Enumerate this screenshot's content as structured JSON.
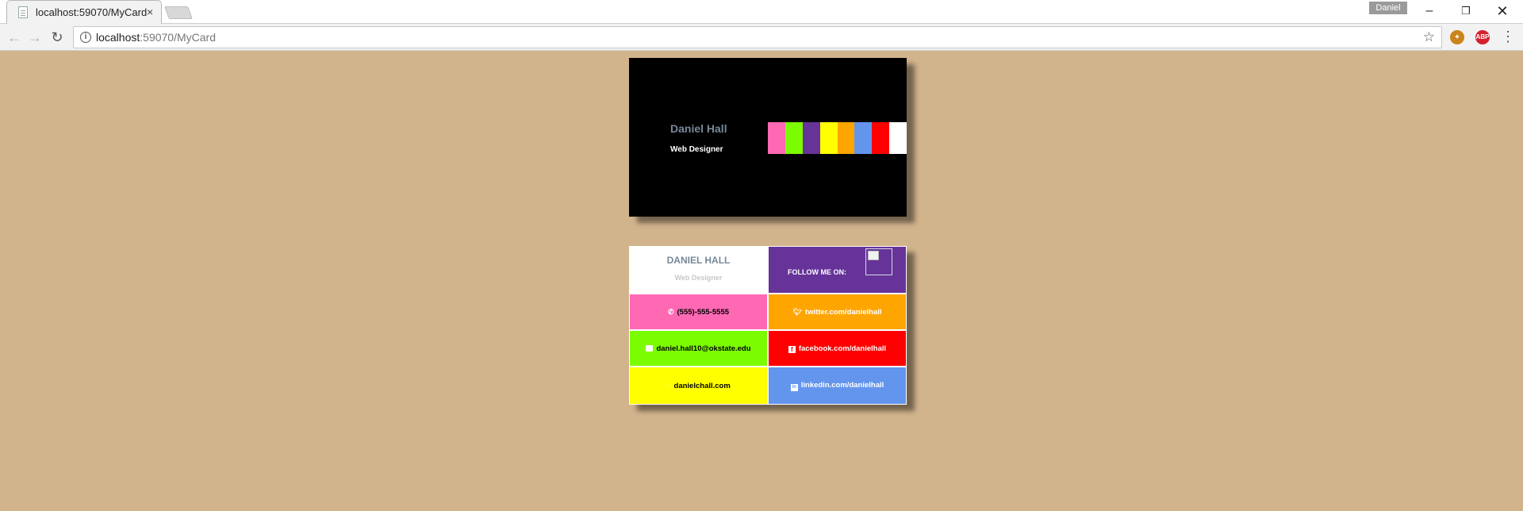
{
  "browser": {
    "tab_title": "localhost:59070/MyCard",
    "tab_close": "×",
    "profile_name": "Daniel",
    "url_host": "localhost",
    "url_path": ":59070/MyCard",
    "window_min": "–",
    "window_max": "❐",
    "window_close": "✕",
    "nav_back": "←",
    "nav_forward": "→",
    "nav_reload": "↻",
    "star": "☆",
    "ext_abp": "ABP",
    "menu": "⋮"
  },
  "page": {
    "background": "#d2b48c"
  },
  "card_front": {
    "name": "Daniel Hall",
    "title": "Web Designer",
    "stripe_colors": [
      "#ff69b4",
      "#7cfc00",
      "#663399",
      "#ffff00",
      "#ffa500",
      "#6495ed",
      "#ff0000",
      "#ffffff"
    ]
  },
  "card_back": {
    "name": "DANIEL HALL",
    "title": "Web Designer",
    "follow_label": "FOLLOW ME ON:",
    "phone": "(555)-555-5555",
    "email": "daniel.hall10@okstate.edu",
    "website": "danielchall.com",
    "twitter": "twitter.com/danielhall",
    "facebook": "facebook.com/danielhall",
    "linkedin": "linkedin.com/danielhall",
    "icons": {
      "phone": "phone-icon",
      "email": "envelope-icon",
      "website": "globe-icon",
      "twitter": "twitter-icon",
      "facebook": "facebook-icon",
      "linkedin": "linkedin-icon"
    }
  }
}
